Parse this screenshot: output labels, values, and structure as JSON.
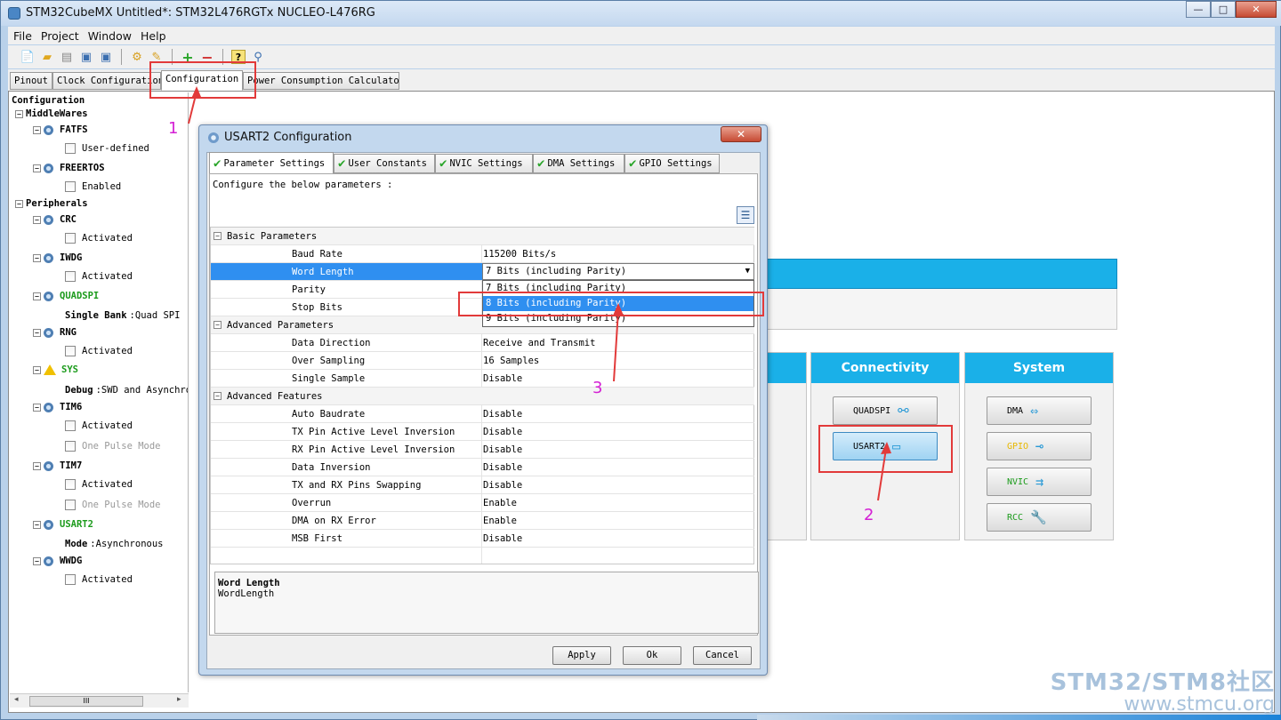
{
  "window": {
    "title": "STM32CubeMX Untitled*: STM32L476RGTx NUCLEO-L476RG",
    "min": "—",
    "max": "□",
    "close": "✕"
  },
  "menu": [
    "File",
    "Project",
    "Window",
    "Help"
  ],
  "toolbar_icons": [
    "new-project-icon",
    "open-icon",
    "copy-icon",
    "save-icon",
    "save-as-icon",
    "generate-code-icon",
    "report-icon",
    "zoom-in-icon",
    "zoom-out-icon",
    "help-icon",
    "search-icon"
  ],
  "main_tabs": [
    "Pinout",
    "Clock Configuration",
    "Configuration",
    "Power Consumption Calculator"
  ],
  "tree": {
    "root": "Configuration",
    "middlewares": "MiddleWares",
    "fatfs": "FATFS",
    "fatfs_opt": "User-defined",
    "freertos": "FREERTOS",
    "freertos_opt": "Enabled",
    "peripherals": "Peripherals",
    "crc": "CRC",
    "crc_opt": "Activated",
    "iwdg": "IWDG",
    "iwdg_opt": "Activated",
    "quadspi": "QUADSPI",
    "quadspi_mode_label": "Single Bank",
    "quadspi_mode_value": ":Quad SPI",
    "rng": "RNG",
    "rng_opt": "Activated",
    "sys": "SYS",
    "sys_mode_label": "Debug",
    "sys_mode_value": ":SWD and Asynchro",
    "tim6": "TIM6",
    "tim6_opt1": "Activated",
    "tim6_opt2": "One Pulse Mode",
    "tim7": "TIM7",
    "tim7_opt1": "Activated",
    "tim7_opt2": "One Pulse Mode",
    "usart2": "USART2",
    "usart2_mode_label": "Mode",
    "usart2_mode_value": ":Asynchronous",
    "wwdg": "WWDG",
    "wwdg_opt": "Activated",
    "scroll_thumb": "III"
  },
  "panels": {
    "connectivity": "Connectivity",
    "system": "System",
    "conn_buttons": [
      "QUADSPI",
      "USART2"
    ],
    "sys_buttons": [
      "DMA",
      "GPIO",
      "NVIC",
      "RCC"
    ]
  },
  "dialog": {
    "title": "USART2 Configuration",
    "close": "✕",
    "tabs": [
      "Parameter Settings",
      "User Constants",
      "NVIC Settings",
      "DMA Settings",
      "GPIO Settings"
    ],
    "intro": "Configure the below parameters :",
    "groups": {
      "basic": "Basic Parameters",
      "advanced": "Advanced Parameters",
      "features": "Advanced Features"
    },
    "params": {
      "baud_rate": {
        "name": "Baud Rate",
        "value": "115200 Bits/s"
      },
      "word_length": {
        "name": "Word Length",
        "value": "7 Bits (including Parity)"
      },
      "parity": {
        "name": "Parity",
        "value": ""
      },
      "stop_bits": {
        "name": "Stop Bits",
        "value": ""
      },
      "data_direction": {
        "name": "Data Direction",
        "value": "Receive and Transmit"
      },
      "over_sampling": {
        "name": "Over Sampling",
        "value": "16 Samples"
      },
      "single_sample": {
        "name": "Single Sample",
        "value": "Disable"
      },
      "auto_baudrate": {
        "name": "Auto Baudrate",
        "value": "Disable"
      },
      "tx_inversion": {
        "name": "TX Pin Active Level Inversion",
        "value": "Disable"
      },
      "rx_inversion": {
        "name": "RX Pin Active Level Inversion",
        "value": "Disable"
      },
      "data_inversion": {
        "name": "Data Inversion",
        "value": "Disable"
      },
      "swap": {
        "name": "TX and RX Pins Swapping",
        "value": "Disable"
      },
      "overrun": {
        "name": "Overrun",
        "value": "Enable"
      },
      "dma_rx_error": {
        "name": "DMA on RX Error",
        "value": "Enable"
      },
      "msb_first": {
        "name": "MSB First",
        "value": "Disable"
      }
    },
    "dropdown_options": [
      "7 Bits (including Parity)",
      "8 Bits (including Parity)",
      "9 Bits (including Parity)"
    ],
    "description_title": "Word Length",
    "description_text": "WordLength",
    "buttons": {
      "apply": "Apply",
      "ok": "Ok",
      "cancel": "Cancel"
    }
  },
  "annotations": [
    "1",
    "2",
    "3"
  ],
  "watermark": {
    "line1": "STM32/STM8社区",
    "line2": "www.stmcu.org"
  },
  "colors": {
    "accent": "#1ab0e8",
    "selection": "#2f8ff0",
    "annotation_box": "#e23a3a",
    "annotation_number": "#d420d4"
  }
}
